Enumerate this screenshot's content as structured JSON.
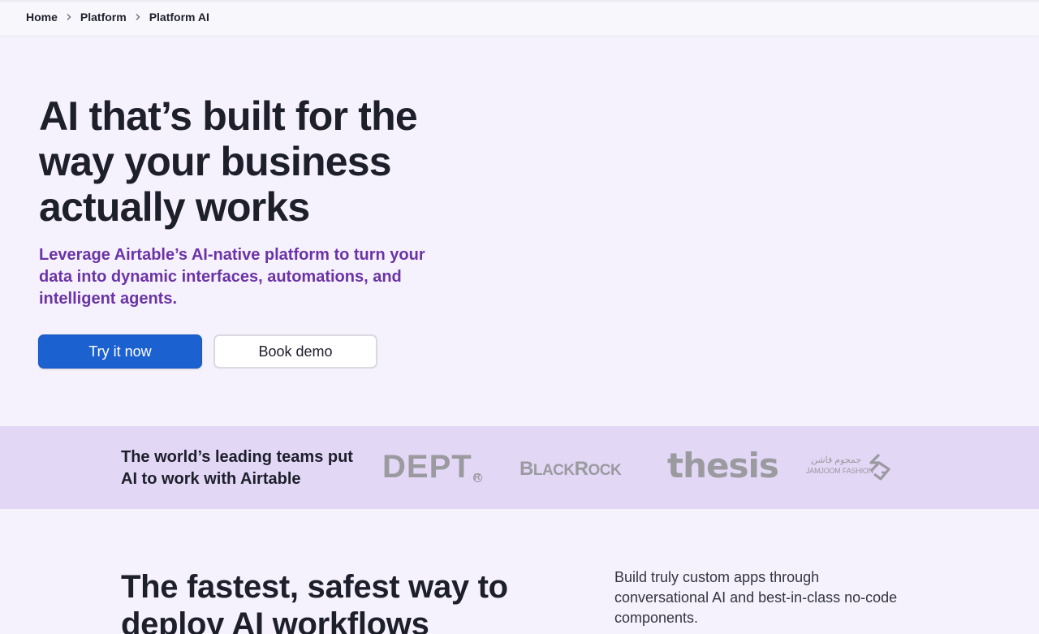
{
  "breadcrumb": {
    "items": [
      "Home",
      "Platform",
      "Platform AI"
    ]
  },
  "hero": {
    "title": "AI that’s built for the way your business actually works",
    "subtitle": "Leverage Airtable’s AI-native platform to turn your data into dynamic interfaces, automations, and intelligent agents.",
    "primary_button": "Try it now",
    "secondary_button": "Book demo"
  },
  "logos": {
    "heading": "The world’s leading teams put AI to work with Airtable",
    "dept": "DEPT",
    "dept_reg": "R",
    "blackrock_b": "B",
    "blackrock_lack": "LACK",
    "blackrock_r": "R",
    "blackrock_ock": "OCK",
    "thesis": "thesis",
    "jamjoom_arabic": "جمجوم فاشن",
    "jamjoom_english": "JAMJOOM FASHION"
  },
  "section2": {
    "title": "The fastest, safest way to deploy AI workflows",
    "text": "Build truly custom apps through conversational AI and best-in-class no-code components."
  },
  "colors": {
    "page_bg": "#f5f2fd",
    "primary": "#1c61d0",
    "subtitle": "#6b33a6",
    "strip_bg": "#e3d7f6"
  }
}
